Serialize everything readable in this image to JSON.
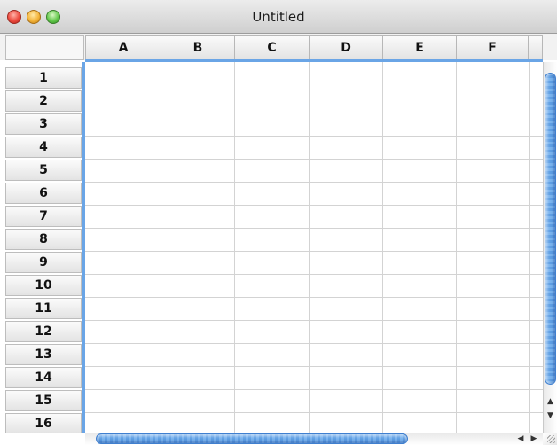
{
  "window": {
    "title": "Untitled"
  },
  "spreadsheet": {
    "columns": [
      "A",
      "B",
      "C",
      "D",
      "E",
      "F"
    ],
    "rows": [
      "1",
      "2",
      "3",
      "4",
      "5",
      "6",
      "7",
      "8",
      "9",
      "10",
      "11",
      "12",
      "13",
      "14",
      "15",
      "16"
    ]
  },
  "colors": {
    "selection_accent": "#6aa5e6",
    "scroll_thumb": "#5e9fe4"
  },
  "icons": {
    "close": "close-icon",
    "minimize": "minimize-icon",
    "maximize": "maximize-icon",
    "scroll_up": "arrow-up-icon",
    "scroll_down": "arrow-down-icon",
    "scroll_left": "arrow-left-icon",
    "scroll_right": "arrow-right-icon"
  }
}
